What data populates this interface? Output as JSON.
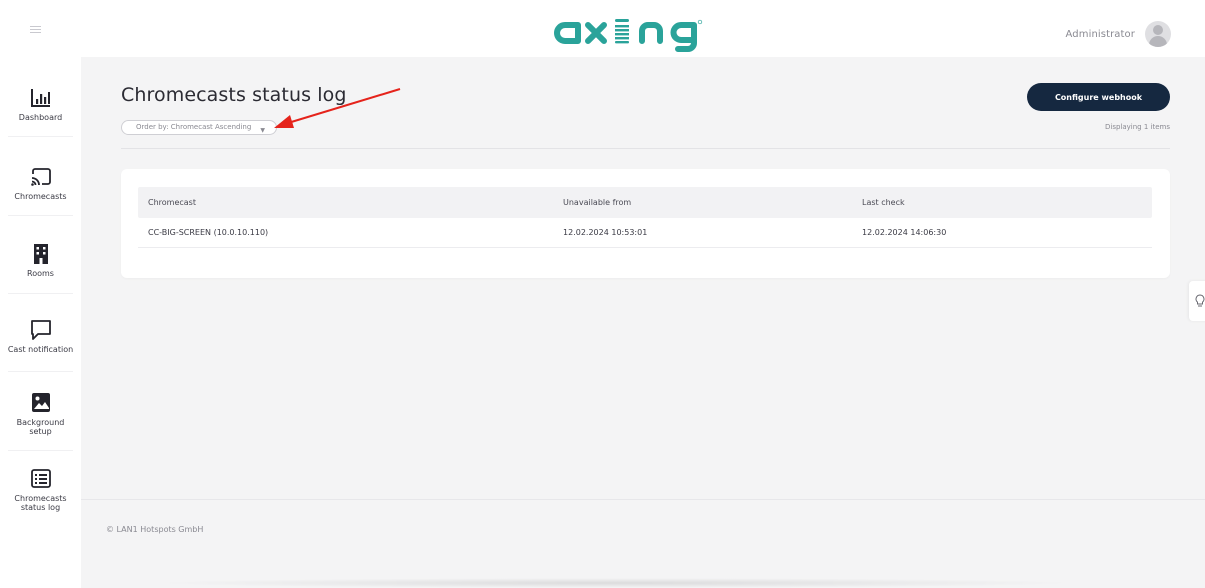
{
  "header": {
    "brand": "axing",
    "user_name": "Administrator"
  },
  "sidebar": {
    "items": [
      {
        "id": "dashboard",
        "label": "Dashboard",
        "icon": "bar-chart-icon"
      },
      {
        "id": "chromecasts",
        "label": "Chromecasts",
        "icon": "cast-icon"
      },
      {
        "id": "rooms",
        "label": "Rooms",
        "icon": "building-icon"
      },
      {
        "id": "cast-notification",
        "label": "Cast notification",
        "icon": "message-icon"
      },
      {
        "id": "background-setup",
        "label_line1": "Background",
        "label_line2": "setup",
        "icon": "image-icon"
      },
      {
        "id": "status-log",
        "label_line1": "Chromecasts",
        "label_line2": "status log",
        "icon": "list-icon"
      }
    ]
  },
  "main": {
    "title": "Chromecasts status log",
    "order_select": "Order by: Chromecast Ascending",
    "configure_button": "Configure webhook",
    "displaying": "Displaying 1 items",
    "table": {
      "columns": [
        "Chromecast",
        "Unavailable from",
        "Last check"
      ],
      "rows": [
        [
          "CC-BIG-SCREEN (10.0.10.110)",
          "12.02.2024 10:53:01",
          "12.02.2024 14:06:30"
        ]
      ]
    }
  },
  "footer": {
    "copyright": "© LAN1 Hotspots GmbH"
  },
  "colors": {
    "brand_teal": "#2aa39a",
    "button_navy": "#152840",
    "annotation_red": "#e5231b"
  }
}
